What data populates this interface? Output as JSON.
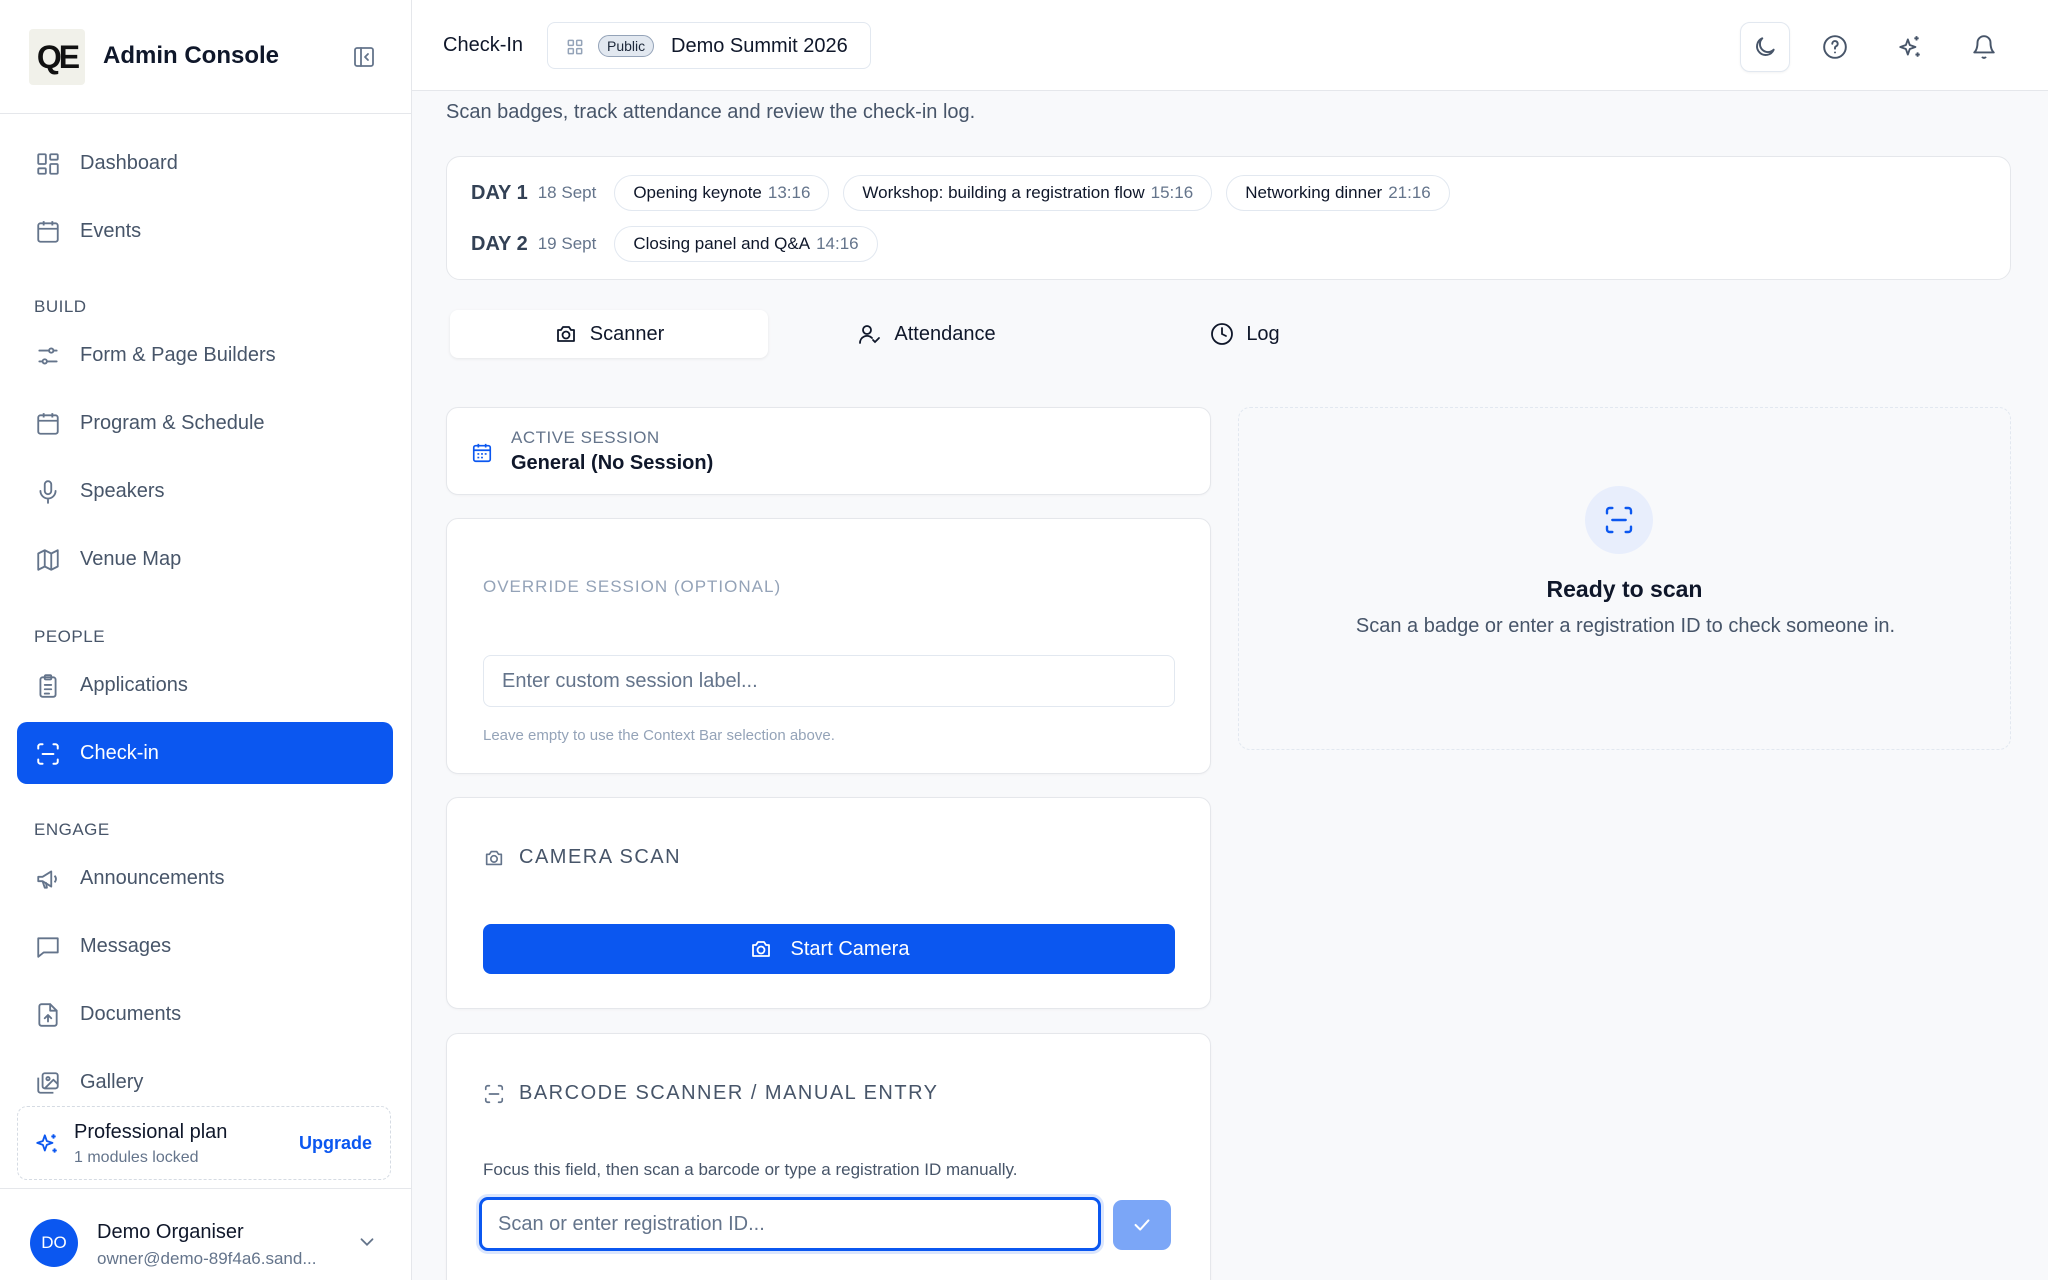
{
  "app": {
    "brand_logo": "QE",
    "brand_title": "Admin Console"
  },
  "sidebar": {
    "items": [
      {
        "label": "Dashboard",
        "icon": "grid-icon"
      },
      {
        "label": "Events",
        "icon": "calendar-icon"
      }
    ],
    "sections": [
      {
        "label": "BUILD",
        "items": [
          {
            "label": "Form & Page Builders",
            "icon": "sliders-icon"
          },
          {
            "label": "Program & Schedule",
            "icon": "calendar-icon"
          },
          {
            "label": "Speakers",
            "icon": "microphone-icon"
          },
          {
            "label": "Venue Map",
            "icon": "map-icon"
          }
        ]
      },
      {
        "label": "PEOPLE",
        "items": [
          {
            "label": "Applications",
            "icon": "clipboard-icon"
          },
          {
            "label": "Check-in",
            "icon": "scan-icon",
            "active": true
          }
        ]
      },
      {
        "label": "ENGAGE",
        "items": [
          {
            "label": "Announcements",
            "icon": "megaphone-icon"
          },
          {
            "label": "Messages",
            "icon": "message-icon"
          },
          {
            "label": "Documents",
            "icon": "document-icon"
          },
          {
            "label": "Gallery",
            "icon": "images-icon"
          }
        ]
      }
    ],
    "plan": {
      "title": "Professional plan",
      "subtitle": "1 modules locked",
      "upgrade_label": "Upgrade"
    },
    "user": {
      "initials": "DO",
      "name": "Demo Organiser",
      "email": "owner@demo-89f4a6.sand..."
    }
  },
  "header": {
    "breadcrumb": "Check-In",
    "event_badge": "Public",
    "event_name": "Demo Summit 2026",
    "actions": [
      "moon-icon",
      "help-icon",
      "sparkles-icon",
      "bell-icon"
    ]
  },
  "page": {
    "subtitle": "Scan badges, track attendance and review the check-in log.",
    "days": [
      {
        "label": "DAY 1",
        "date": "18 Sept",
        "sessions": [
          {
            "name": "Opening keynote",
            "time": "13:16"
          },
          {
            "name": "Workshop: building a registration flow",
            "time": "15:16"
          },
          {
            "name": "Networking dinner",
            "time": "21:16"
          }
        ]
      },
      {
        "label": "DAY 2",
        "date": "19 Sept",
        "sessions": [
          {
            "name": "Closing panel and Q&A",
            "time": "14:16"
          }
        ]
      }
    ],
    "tabs": [
      {
        "label": "Scanner",
        "icon": "camera-icon",
        "active": true
      },
      {
        "label": "Attendance",
        "icon": "user-check-icon"
      },
      {
        "label": "Log",
        "icon": "clock-icon"
      }
    ],
    "active_session": {
      "label": "ACTIVE SESSION",
      "value": "General (No Session)"
    },
    "override": {
      "label": "OVERRIDE SESSION (OPTIONAL)",
      "placeholder": "Enter custom session label...",
      "value": "",
      "hint": "Leave empty to use the Context Bar selection above."
    },
    "camera": {
      "title": "CAMERA SCAN",
      "button_label": "Start Camera"
    },
    "barcode": {
      "title": "BARCODE SCANNER / MANUAL ENTRY",
      "hint": "Focus this field, then scan a barcode or type a registration ID manually.",
      "placeholder": "Scan or enter registration ID...",
      "value": ""
    },
    "ready": {
      "title": "Ready to scan",
      "text": "Scan a badge or enter a registration ID to check someone in."
    }
  },
  "colors": {
    "accent": "#0b57f0",
    "background": "#f8f9fb",
    "text": "#0f172a",
    "muted": "#64748b"
  }
}
